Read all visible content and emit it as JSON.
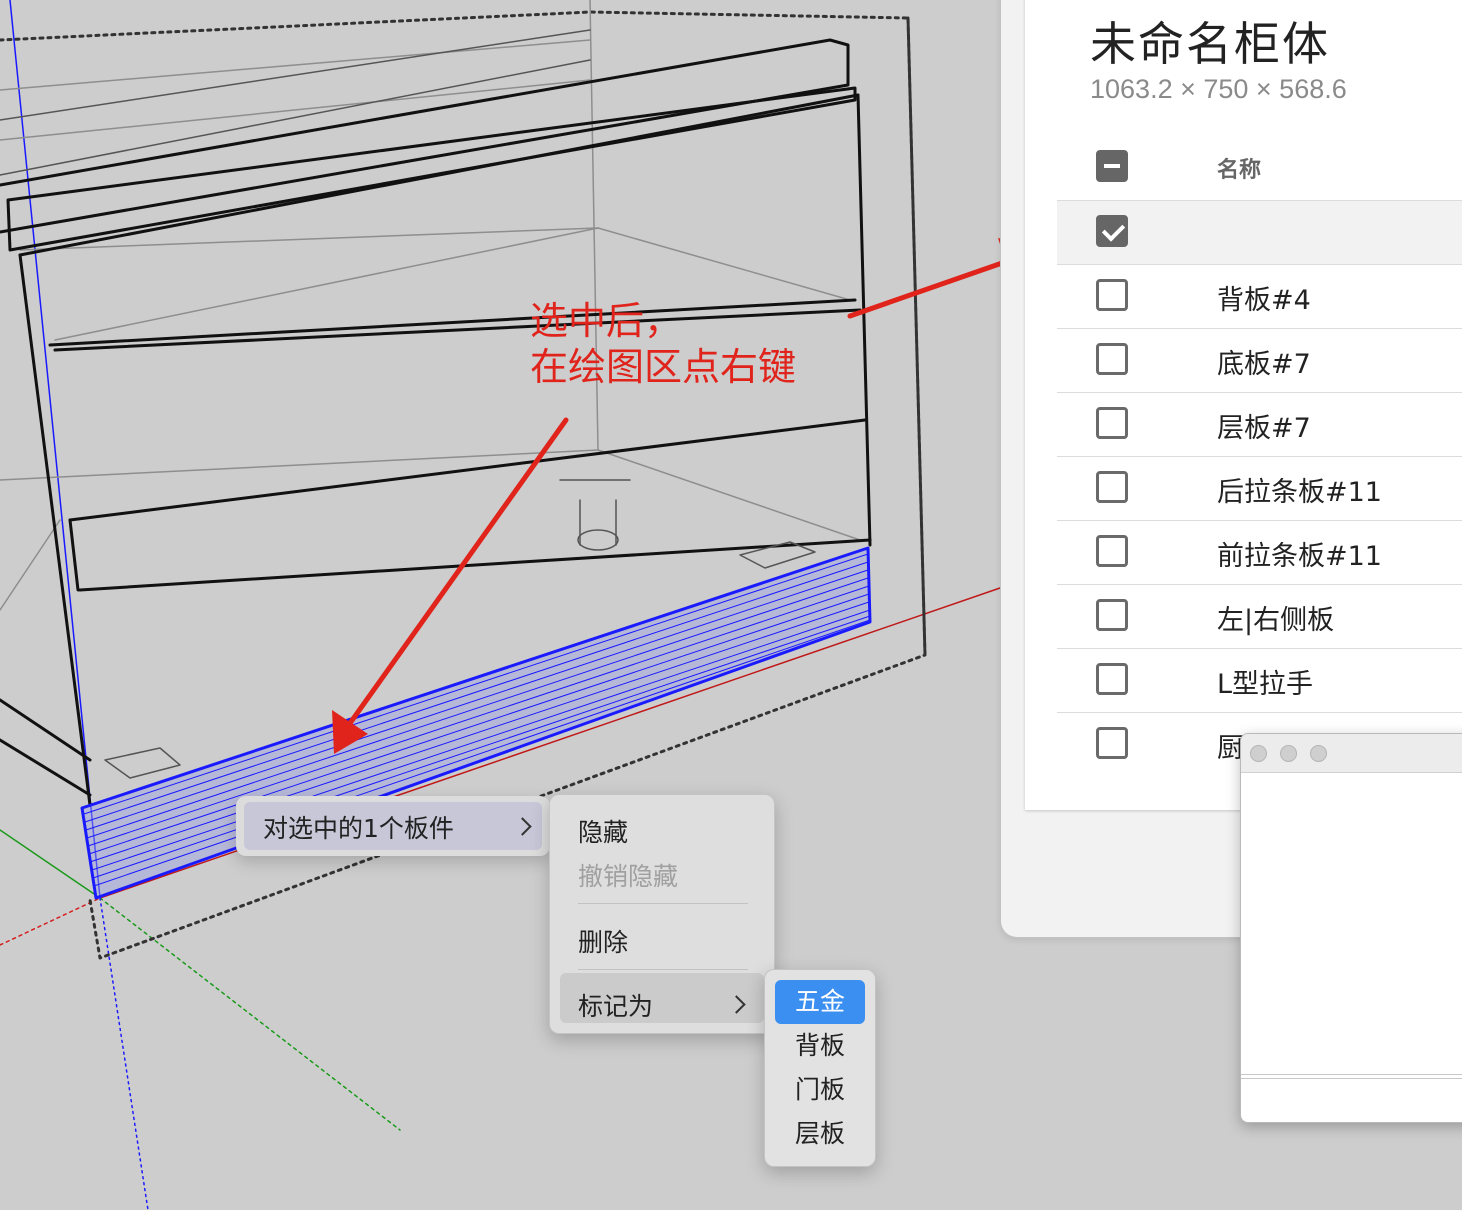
{
  "annotation": {
    "text": "选中后，\n在绘图区点右键",
    "color": "#e0241b"
  },
  "panel": {
    "title": "未命名柜体",
    "dimensions": "1063.2 × 750 × 568.6",
    "header": {
      "name_column": "名称",
      "select_all_state": "indeterminate"
    },
    "rows": [
      {
        "label": "",
        "checked": true,
        "selected": true
      },
      {
        "label": "背板#4",
        "checked": false
      },
      {
        "label": "底板#7",
        "checked": false
      },
      {
        "label": "层板#7",
        "checked": false
      },
      {
        "label": "后拉条板#11",
        "checked": false
      },
      {
        "label": "前拉条板#11",
        "checked": false
      },
      {
        "label": "左|右侧板",
        "checked": false
      },
      {
        "label": "L型拉手",
        "checked": false
      },
      {
        "label": "厨",
        "checked": false
      }
    ]
  },
  "context_menu": {
    "root_item": "对选中的1个板件",
    "items": {
      "hide": "隐藏",
      "unhide": "撤销隐藏",
      "delete": "删除",
      "mark_as": "标记为"
    },
    "mark_as_options": [
      "五金",
      "背板",
      "门板",
      "层板"
    ],
    "active_option": "五金"
  },
  "colors": {
    "selection_blue": "#1a1aff",
    "axis_red": "#d42020",
    "axis_green": "#1a9a1a",
    "menu_accent": "#3b8ff0"
  }
}
